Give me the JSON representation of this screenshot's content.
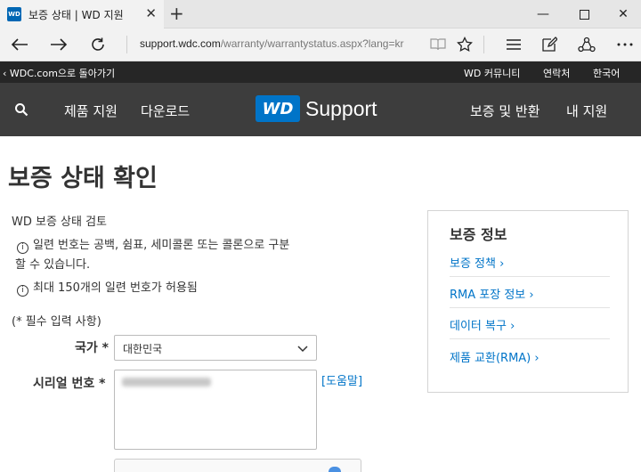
{
  "browser": {
    "tab_title": "보증 상태 | WD 지원",
    "tab_favicon_text": "WD",
    "url_host": "support.wdc.com",
    "url_path": "/warranty/warrantystatus.aspx?lang=kr"
  },
  "site_header": {
    "back_link": "WDC.com으로 돌아가기",
    "community": "WD 커뮤니티",
    "contact": "연락처",
    "language": "한국어",
    "nav_product_support": "제품 지원",
    "nav_downloads": "다운로드",
    "logo_text": "WD",
    "logo_support": "Support",
    "nav_warranty_returns": "보증 및 반환",
    "nav_my_support": "내 지원"
  },
  "main": {
    "page_title": "보증 상태 확인",
    "subtitle": "WD 보증 상태 검토",
    "info_1_line1": "일련 번호는 공백, 쉼표, 세미콜론 또는 콜론으로 구분",
    "info_1_line2": "할 수 있습니다.",
    "info_2": "최대 150개의 일련 번호가 허용됨",
    "info_mark": "i",
    "required_note": "(* 필수 입력 사항)",
    "country_label": "국가 *",
    "country_value": "대한민국",
    "serial_label": "시리얼 번호 *",
    "help_link": "[도움말]"
  },
  "sidebar": {
    "title": "보증 정보",
    "links": [
      "보증 정책 ›",
      "RMA 포장 정보 ›",
      "데이터 복구 ›",
      "제품 교환(RMA) ›"
    ]
  }
}
